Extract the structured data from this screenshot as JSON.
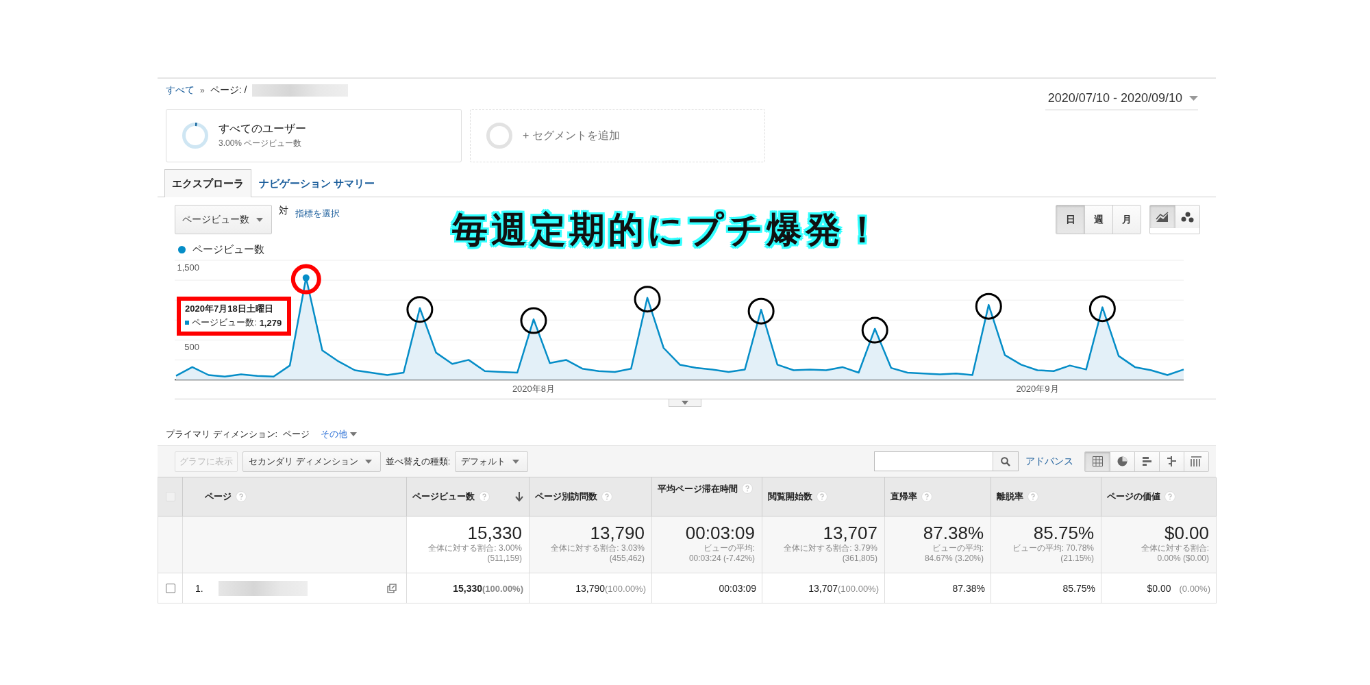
{
  "breadcrumb": {
    "root": "すべて",
    "separator": "»",
    "current": "ページ: /"
  },
  "date_range": "2020/07/10 - 2020/09/10",
  "segments": [
    {
      "kind": "active",
      "title": "すべてのユーザー",
      "subtitle": "3.00% ページビュー数"
    },
    {
      "kind": "add",
      "title": "+ セグメントを追加"
    }
  ],
  "tabs": [
    {
      "label": "エクスプローラ",
      "selected": true
    },
    {
      "label": "ナビゲーション サマリー",
      "selected": false
    }
  ],
  "chart_controls": {
    "metric": "ページビュー数",
    "versus": "対",
    "select_metric": "指標を選択",
    "periods": [
      {
        "label": "日",
        "selected": true
      },
      {
        "label": "週",
        "selected": false
      },
      {
        "label": "月",
        "selected": false
      }
    ],
    "chart_types": [
      {
        "kind": "line",
        "selected": true
      },
      {
        "kind": "motion",
        "selected": false
      }
    ]
  },
  "headline": "毎週定期的にプチ爆発！",
  "chart_data": {
    "type": "area",
    "categories": [
      null,
      null,
      null,
      null,
      null,
      null,
      null,
      null,
      null,
      null,
      null,
      null,
      null,
      null,
      null,
      null,
      null,
      null,
      null,
      null,
      null,
      null,
      "2020年8月",
      null,
      null,
      null,
      null,
      null,
      null,
      null,
      null,
      null,
      null,
      null,
      null,
      null,
      null,
      null,
      null,
      null,
      null,
      null,
      null,
      null,
      null,
      null,
      null,
      null,
      null,
      null,
      null,
      null,
      null,
      "2020年9月",
      null,
      null,
      null,
      null,
      null,
      null,
      null,
      null,
      null
    ],
    "series": [
      {
        "name": "ページビュー数",
        "color": "#058dc7",
        "values": [
          50,
          160,
          60,
          40,
          70,
          50,
          40,
          180,
          1280,
          370,
          230,
          120,
          90,
          60,
          90,
          900,
          340,
          200,
          250,
          110,
          100,
          90,
          760,
          210,
          250,
          140,
          110,
          100,
          140,
          1030,
          400,
          190,
          150,
          130,
          100,
          130,
          880,
          190,
          120,
          130,
          120,
          160,
          90,
          640,
          150,
          90,
          80,
          70,
          80,
          60,
          940,
          310,
          190,
          120,
          110,
          180,
          130,
          910,
          300,
          160,
          120,
          60,
          130
        ]
      }
    ],
    "ylim": [
      0,
      1500
    ],
    "yticks": [
      {
        "value": 500,
        "label": "500"
      },
      {
        "value": 1500,
        "label": "1,500"
      }
    ],
    "ylabel": null
  },
  "tooltip": {
    "title": "2020年7月18日土曜日",
    "label": "ページビュー数:",
    "value": "1,279",
    "highlighted": true
  },
  "peak_marks": [
    {
      "color": "#ff0000"
    },
    {
      "color": "#000000"
    },
    {
      "color": "#000000"
    },
    {
      "color": "#000000"
    },
    {
      "color": "#000000"
    },
    {
      "color": "#000000"
    },
    {
      "color": "#000000"
    },
    {
      "color": "#000000"
    }
  ],
  "primary_dimension": {
    "label": "プライマリ ディメンション:",
    "value": "ページ",
    "other": "その他"
  },
  "toolbar": {
    "plot_rows": {
      "label": "グラフに表示",
      "disabled": true
    },
    "secondary": "セカンダリ ディメンション",
    "sort_label": "並べ替えの種類:",
    "sort": "デフォルト",
    "advanced": "アドバンス",
    "views": [
      {
        "kind": "table",
        "selected": true
      },
      {
        "kind": "pie",
        "selected": false
      },
      {
        "kind": "bar",
        "selected": false
      },
      {
        "kind": "comparison",
        "selected": false
      },
      {
        "kind": "pivot",
        "selected": false
      }
    ]
  },
  "table": {
    "select_all_checked": false,
    "columns": [
      {
        "label": "ページ",
        "sorted": false
      },
      {
        "label": "ページビュー数",
        "sorted": true
      },
      {
        "label": "ページ別訪問数",
        "sorted": false
      },
      {
        "label": "平均ページ滞在時間",
        "sorted": false
      },
      {
        "label": "閲覧開始数",
        "sorted": false
      },
      {
        "label": "直帰率",
        "sorted": false
      },
      {
        "label": "離脱率",
        "sorted": false
      },
      {
        "label": "ページの価値",
        "sorted": false
      }
    ],
    "totals": [
      {
        "value": "15,330",
        "lines": [
          "全体に対する割合: 3.00%",
          "(511,159)"
        ]
      },
      {
        "value": "13,790",
        "lines": [
          "全体に対する割合: 3.03%",
          "(455,462)"
        ]
      },
      {
        "value": "00:03:09",
        "lines": [
          "ビューの平均:",
          "00:03:24 (-7.42%)"
        ]
      },
      {
        "value": "13,707",
        "lines": [
          "全体に対する割合: 3.79%",
          "(361,805)"
        ]
      },
      {
        "value": "87.38%",
        "lines": [
          "ビューの平均:",
          "84.67% (3.20%)"
        ]
      },
      {
        "value": "85.75%",
        "lines": [
          "ビューの平均: 70.78%",
          "(21.15%)"
        ]
      },
      {
        "value": "$0.00",
        "lines": [
          "全体に対する割合:",
          "0.00% ($0.00)"
        ]
      }
    ],
    "rows": [
      {
        "index": "1.",
        "checked": false,
        "cells": [
          {
            "value": "15,330",
            "share": "(100.00%)",
            "bold": true
          },
          {
            "value": "13,790",
            "share": "(100.00%)",
            "bold": false
          },
          {
            "value": "00:03:09",
            "bold": false
          },
          {
            "value": "13,707",
            "share": "(100.00%)",
            "bold": false
          },
          {
            "value": "87.38%",
            "bold": false
          },
          {
            "value": "85.75%",
            "bold": false
          },
          {
            "value": "$0.00",
            "share": "(0.00%)",
            "bold": false
          }
        ]
      }
    ]
  }
}
